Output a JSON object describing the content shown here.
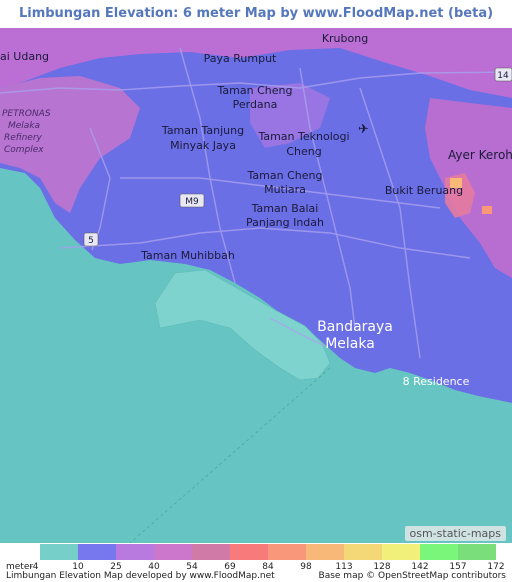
{
  "title": "Limbungan Elevation: 6 meter Map by www.FloodMap.net (beta)",
  "map_labels": {
    "krubong": "Krubong",
    "ai_udang": "ai Udang",
    "paya_rumput": "Paya Rumput",
    "taman_cheng_perdana_1": "Taman Cheng",
    "taman_cheng_perdana_2": "Perdana",
    "taman_tanjung_1": "Taman Tanjung",
    "taman_tanjung_2": "Minyak Jaya",
    "taman_teknologi_1": "Taman Teknologi",
    "taman_teknologi_2": "Cheng",
    "taman_cheng_mutiara_1": "Taman Cheng",
    "taman_cheng_mutiara_2": "Mutiara",
    "taman_balai_1": "Taman Balai",
    "taman_balai_2": "Panjang Indah",
    "taman_muhibbah": "Taman Muhibbah",
    "bandaraya_1": "Bandaraya",
    "bandaraya_2": "Melaka",
    "ayer_keroh": "Ayer Keroh",
    "bukit_beruang": "Bukit Beruang",
    "eight_residence": "8 Residence",
    "petronas_1": "PETRONAS",
    "petronas_2": "Melaka",
    "petronas_3": "Refinery",
    "petronas_4": "Complex",
    "route_m9": "M9",
    "route_5": "5",
    "route_14": "14"
  },
  "attribution": "osm-static-maps",
  "legend": {
    "unit": "meter",
    "ticks": [
      "-4",
      "10",
      "25",
      "40",
      "54",
      "69",
      "84",
      "98",
      "113",
      "128",
      "142",
      "157",
      "172"
    ],
    "colors": [
      "#76cfc8",
      "#7777ee",
      "#b87adf",
      "#cc77cc",
      "#d07aa8",
      "#f87a7a",
      "#f8977a",
      "#f8b877",
      "#f4d777",
      "#f0f07a",
      "#7af77a",
      "#7adf7a"
    ]
  },
  "footer": {
    "left": "Limbungan Elevation Map developed by www.FloodMap.net",
    "right": "Base map © OpenStreetMap contributors"
  }
}
